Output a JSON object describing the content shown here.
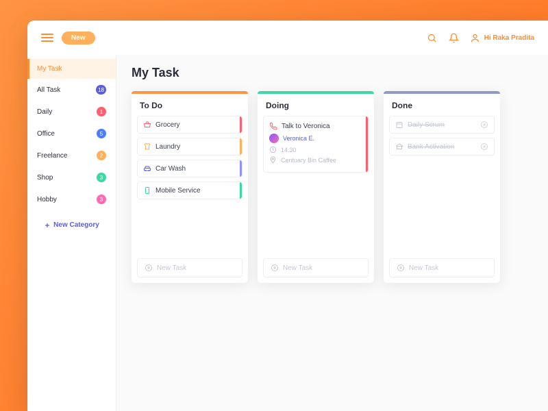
{
  "topbar": {
    "new_label": "New",
    "greeting": "Hi Raka Pradita"
  },
  "sidebar": {
    "items": [
      {
        "label": "My Task",
        "badge": null,
        "active": true
      },
      {
        "label": "All Task",
        "badge": "18",
        "color": "#5a5fd8"
      },
      {
        "label": "Daily",
        "badge": "1",
        "color": "#ff5f6f"
      },
      {
        "label": "Office",
        "badge": "5",
        "color": "#4a7dff"
      },
      {
        "label": "Freelance",
        "badge": "2",
        "color": "#ffb05c"
      },
      {
        "label": "Shop",
        "badge": "3",
        "color": "#3dd9a4"
      },
      {
        "label": "Hobby",
        "badge": "3",
        "color": "#ff6bb0"
      }
    ],
    "new_category": "New Category"
  },
  "board": {
    "title": "My Task",
    "columns": {
      "todo": {
        "title": "To Do",
        "bar": "#ff9442",
        "tasks": [
          {
            "label": "Grocery",
            "icon": "basket",
            "icon_color": "#ff5f6f",
            "stripe": "#ff5f6f"
          },
          {
            "label": "Laundry",
            "icon": "shirt",
            "icon_color": "#ffb05c",
            "stripe": "#ffb05c"
          },
          {
            "label": "Car Wash",
            "icon": "car",
            "icon_color": "#5a5fd8",
            "stripe": "#8e93ff"
          },
          {
            "label": "Mobile Service",
            "icon": "mobile",
            "icon_color": "#3dd9a4",
            "stripe": "#3dd9a4"
          }
        ]
      },
      "doing": {
        "title": "Doing",
        "bar": "#3dd9a4",
        "task": {
          "label": "Talk to Veronica",
          "person": "Veronica E.",
          "time": "14.30",
          "location": "Centuary Bin Caffee",
          "stripe": "#ff5f6f"
        }
      },
      "done": {
        "title": "Done",
        "bar": "#8e9bc7",
        "tasks": [
          {
            "label": "Daily Scrum"
          },
          {
            "label": "Bank Activation"
          }
        ]
      }
    },
    "new_task": "New Task"
  }
}
